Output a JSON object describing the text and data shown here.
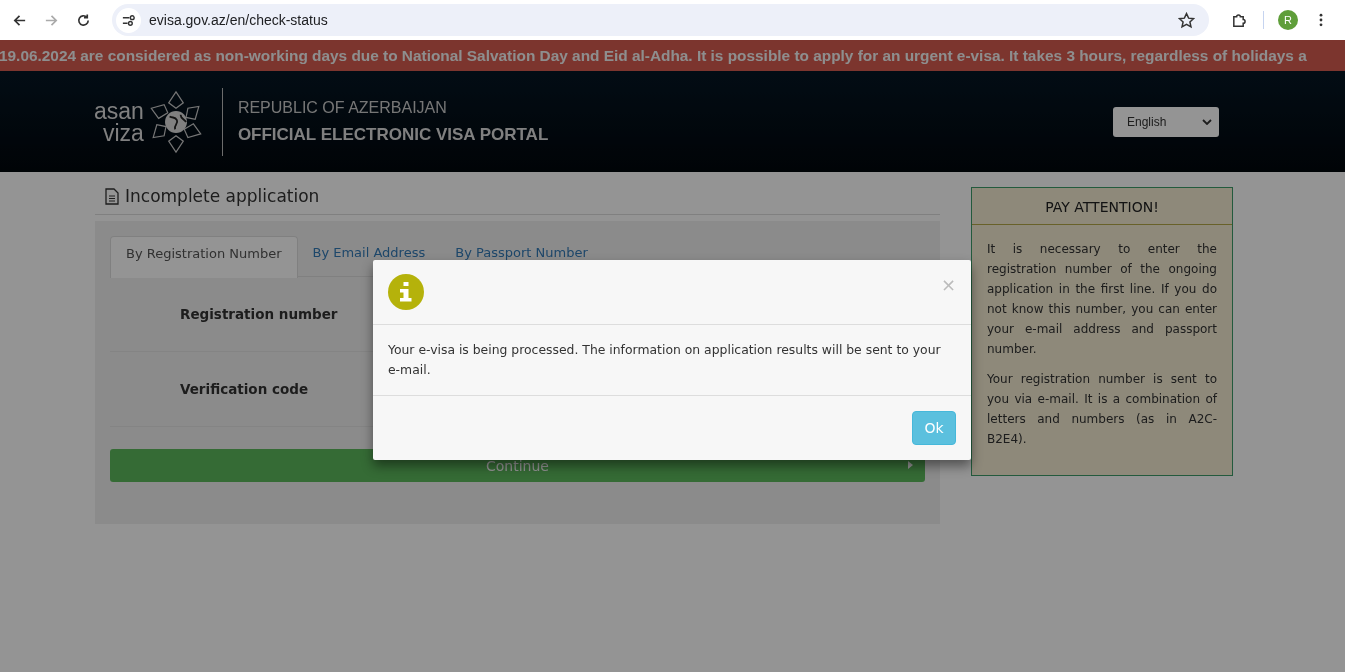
{
  "browser": {
    "url": "evisa.gov.az/en/check-status",
    "profile_initial": "R"
  },
  "notice": {
    "text": "19.06.2024 are considered as non-working days due to National Salvation Day and Eid al-Adha. It is possible to apply for an urgent e-visa. It takes 3 hours, regardless of holidays a"
  },
  "header": {
    "logo_words": [
      "asan",
      "viza"
    ],
    "country": "REPUBLIC OF AZERBAIJAN",
    "portal": "OFFICIAL ELECTRONIC VISA PORTAL",
    "language": "English"
  },
  "main": {
    "heading": "Incomplete application",
    "tabs": [
      {
        "label": "By Registration Number",
        "selected": true
      },
      {
        "label": "By Email Address",
        "selected": false
      },
      {
        "label": "By Passport Number",
        "selected": false
      }
    ],
    "fields": [
      {
        "label": "Registration number"
      },
      {
        "label": "Verification code"
      }
    ],
    "continue_button": "Continue"
  },
  "attention": {
    "title": "PAY ATTENTION!",
    "paragraphs": [
      "It is necessary to enter the registration number of the ongoing application in the first line. If you do not know this number, you can enter your e-mail address and passport number.",
      "Your registration number is sent to you via e-mail. It is a combination of letters and numbers (as in A2C-B2E4)."
    ]
  },
  "modal": {
    "close": "×",
    "message": "Your e-visa is being processed. The information on application results will be sent to your e-mail.",
    "ok_button": "Ok"
  }
}
